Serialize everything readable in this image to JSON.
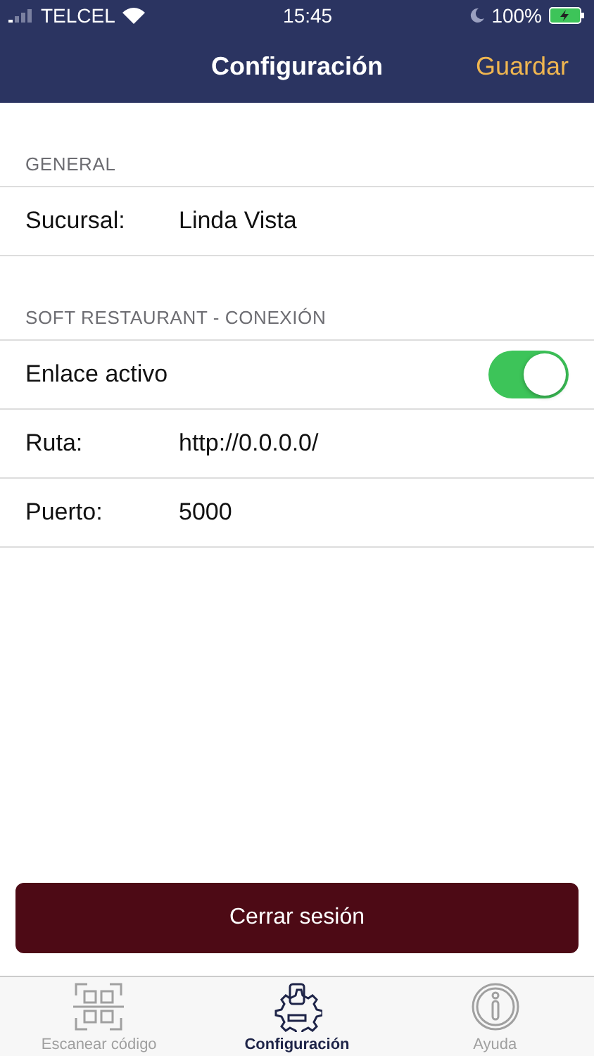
{
  "status_bar": {
    "carrier": "TELCEL",
    "time": "15:45",
    "battery": "100%"
  },
  "nav": {
    "title": "Configuración",
    "action": "Guardar"
  },
  "sections": [
    {
      "header": "GENERAL",
      "rows": [
        {
          "kind": "field",
          "label": "Sucursal:",
          "value": "Linda Vista"
        }
      ]
    },
    {
      "header": "SOFT RESTAURANT - CONEXIÓN",
      "rows": [
        {
          "kind": "toggle",
          "label": "Enlace activo",
          "on": true
        },
        {
          "kind": "field",
          "label": "Ruta:",
          "value": "http://0.0.0.0/"
        },
        {
          "kind": "field",
          "label": "Puerto:",
          "value": "5000"
        }
      ]
    }
  ],
  "logout": "Cerrar sesión",
  "tabs": [
    {
      "label": "Escanear código",
      "selected": false
    },
    {
      "label": "Configuración",
      "selected": true
    },
    {
      "label": "Ayuda",
      "selected": false
    }
  ]
}
